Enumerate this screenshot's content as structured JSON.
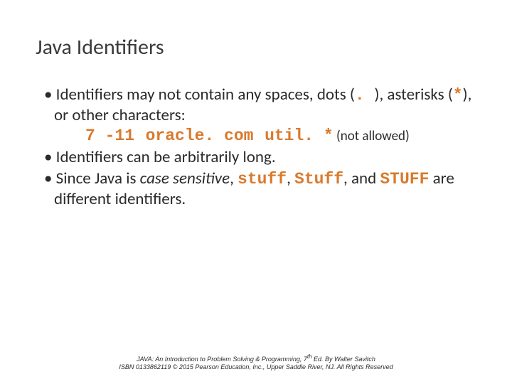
{
  "title": "Java Identifiers",
  "bullets": {
    "b1_a": "Identifiers may not contain any spaces, dots (",
    "b1_b": ". ",
    "b1_c": "), asterisks (",
    "b1_d": "*",
    "b1_e": "), or other characters:",
    "ex1": "7 -11",
    "ex2": "oracle. com",
    "ex3": "util. *",
    "note": " (not allowed)",
    "b2": "Identifiers can be arbitrarily long.",
    "b3_a": "Since Java is ",
    "b3_b": "case sensitive",
    "b3_c": ", ",
    "b3_d": "stuff",
    "b3_e": ", ",
    "b3_f": "Stuff",
    "b3_g": ", ",
    "b3_h": "and ",
    "b3_i": "STUFF",
    "b3_j": " are different identifiers."
  },
  "footer": {
    "line1a": "JAVA: An Introduction to Problem Solving & Programming, 7",
    "line1b": "th",
    "line1c": " Ed. By Walter Savitch",
    "line2": "ISBN 0133862119 © 2015 Pearson Education, Inc., Upper Saddle River, NJ. All Rights Reserved"
  }
}
